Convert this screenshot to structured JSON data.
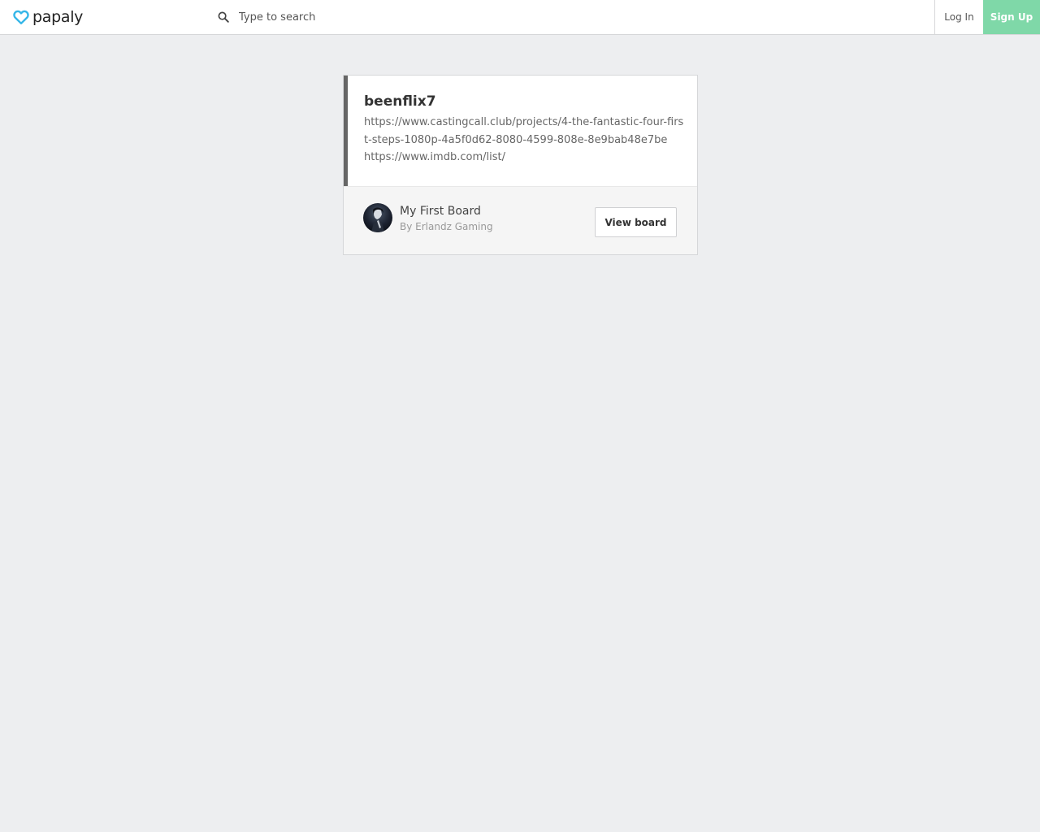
{
  "header": {
    "logo_text": "papaly",
    "search_placeholder": "Type to search",
    "login_label": "Log In",
    "signup_label": "Sign Up"
  },
  "card": {
    "title": "beenflix7",
    "description_line1": "https://www.castingcall.club/projects/4-the-fantastic-four-first-steps-1080p-4a5f0d62-8080-4599-808e-8e9bab48e7be",
    "description_line2": "https://www.imdb.com/list/",
    "board_name": "My First Board",
    "board_author": "By Erlandz Gaming",
    "view_board_label": "View board"
  },
  "colors": {
    "accent_signup": "#7fd8a8",
    "logo_heart": "#35b6e8",
    "background": "#edeef0"
  },
  "icons": {
    "logo": "heart-icon",
    "search": "search-icon"
  }
}
